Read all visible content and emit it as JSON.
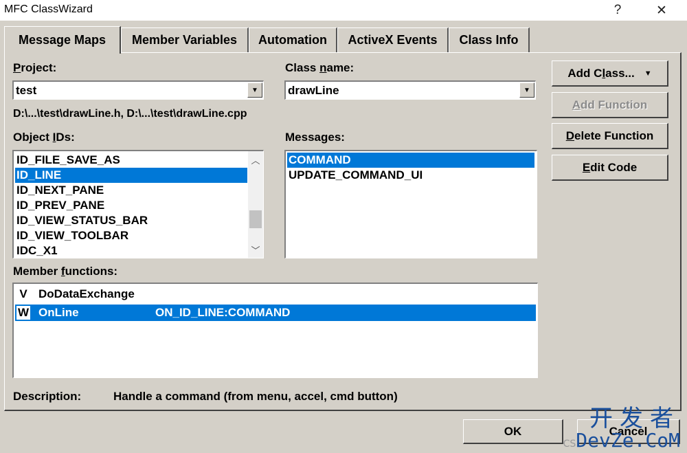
{
  "window": {
    "title": "MFC ClassWizard",
    "help_label": "?",
    "close_label": "✕"
  },
  "tabs": [
    {
      "label": "Message Maps",
      "active": true
    },
    {
      "label": "Member Variables",
      "active": false
    },
    {
      "label": "Automation",
      "active": false
    },
    {
      "label": "ActiveX Events",
      "active": false
    },
    {
      "label": "Class Info",
      "active": false
    }
  ],
  "project": {
    "label_key": "P",
    "label_rest": "roject:",
    "value": "test"
  },
  "class_name": {
    "label_pre": "Class ",
    "label_key": "n",
    "label_post": "ame:",
    "value": "drawLine"
  },
  "file_path": "D:\\...\\test\\drawLine.h, D:\\...\\test\\drawLine.cpp",
  "object_ids": {
    "label_pre": "Object ",
    "label_key": "I",
    "label_post": "Ds:",
    "items": [
      {
        "text": "ID_FILE_SAVE_AS",
        "selected": false
      },
      {
        "text": "ID_LINE",
        "selected": true
      },
      {
        "text": "ID_NEXT_PANE",
        "selected": false
      },
      {
        "text": "ID_PREV_PANE",
        "selected": false
      },
      {
        "text": "ID_VIEW_STATUS_BAR",
        "selected": false
      },
      {
        "text": "ID_VIEW_TOOLBAR",
        "selected": false
      },
      {
        "text": "IDC_X1",
        "selected": false
      }
    ]
  },
  "messages": {
    "label": "Messages:",
    "items": [
      {
        "text": "COMMAND",
        "selected": true
      },
      {
        "text": "UPDATE_COMMAND_UI",
        "selected": false
      }
    ]
  },
  "buttons": {
    "add_class": {
      "pre": "Add C",
      "key": "l",
      "post": "ass...",
      "arrow": "▼"
    },
    "add_function": {
      "key": "A",
      "rest": "dd Function"
    },
    "delete_function": {
      "key": "D",
      "rest": "elete Function"
    },
    "edit_code": {
      "key": "E",
      "rest": "dit Code"
    },
    "ok": "OK",
    "cancel": "Cancel"
  },
  "member_functions": {
    "label_pre": "Member ",
    "label_key": "f",
    "label_post": "unctions:",
    "rows": [
      {
        "type": "V",
        "name": "DoDataExchange",
        "handler": "",
        "selected": false
      },
      {
        "type": "W",
        "name": "OnLine",
        "handler": "ON_ID_LINE:COMMAND",
        "selected": true
      }
    ]
  },
  "description": {
    "label": "Description:",
    "text": "Handle a command (from menu, accel, cmd button)"
  },
  "watermark": {
    "cn": "开发者",
    "en": "DevZe.CoM",
    "prefix": "CS"
  },
  "colors": {
    "dialog_bg": "#d4d0c8",
    "selection": "#0078d7",
    "watermark": "#1a4f9c"
  },
  "icons": {
    "dropdown": "triangle-down-icon",
    "scroll_up": "chevron-up-icon",
    "scroll_down": "chevron-down-icon"
  }
}
